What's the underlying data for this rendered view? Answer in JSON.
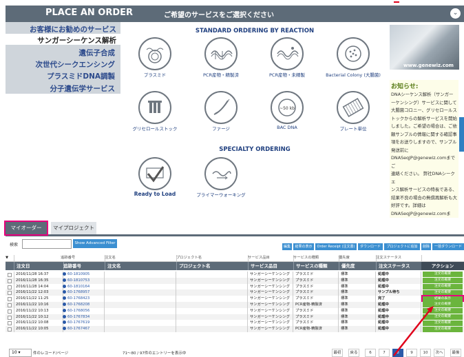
{
  "header": {
    "title": "PLACE AN ORDER",
    "prompt": "ご希望のサービスをご選択ください",
    "collapse_icon": "chevron-down-icon"
  },
  "sidebar": {
    "items": [
      {
        "label": "お客様にお勧めのサービス"
      },
      {
        "label": "サンガーシーケンス解析"
      },
      {
        "label": "遺伝子合成"
      },
      {
        "label": "次世代シークエンシング"
      },
      {
        "label": "プラスミドDNA調製"
      },
      {
        "label": "分子遺伝学サービス"
      }
    ]
  },
  "main": {
    "standard_title": "STANDARD ORDERING BY REACTION",
    "products": [
      {
        "label": "プラスミド",
        "icon": "plasmid-icon"
      },
      {
        "label": "PCR産物・精製済",
        "icon": "pcr-purified-icon"
      },
      {
        "label": "PCR産物・未精製",
        "icon": "pcr-unpurified-icon"
      },
      {
        "label": "Bacterial Colony (大腸菌)",
        "icon": "bacterial-colony-icon"
      },
      {
        "label": "グリセロールストック",
        "icon": "glycerol-stock-icon"
      },
      {
        "label": "ファージ",
        "icon": "phage-icon"
      },
      {
        "label": "BAC DNA",
        "icon": "bac-dna-icon",
        "badge": "~50 kb"
      },
      {
        "label": "プレート単位",
        "icon": "plate-icon"
      }
    ],
    "specialty_title": "SPECIALTY ORDERING",
    "specialty": [
      {
        "label": "Ready to Load",
        "icon": "ready-to-load-icon"
      },
      {
        "label": "プライマーウォーキング",
        "icon": "primer-walking-icon"
      }
    ]
  },
  "right_panel": {
    "photo_caption": "www.genewiz.com",
    "news_title": "お知らせ:",
    "news_lines": [
      "DNAシーケンス解析（サンガー",
      "ーケンシング）サービスに関して",
      "大腸菌コロニー、グリセロールス",
      "トックからの解析サービスを開始",
      "しました。ご希望の場合は、ご依",
      "頼サンプルの情報に関する確認事",
      "項をお送りしますので、サンプル",
      "発送前に",
      "DNASeqJP@genewiz.comまでご",
      "連絡ください。 弊社DNAシークエ",
      "ンス解析サービスの特長である、",
      "結果不良の場合の無償再解析も大",
      "好評です。詳細は",
      "DNASeqJP@genewiz.comまで。"
    ]
  },
  "tabs": [
    {
      "label": "マイオーダー"
    },
    {
      "label": "マイプロジェクト"
    }
  ],
  "search": {
    "label": "検索",
    "advanced_button": "Show Advanced Filter"
  },
  "toolbar": [
    {
      "label": "編集"
    },
    {
      "label": "結果の表示"
    },
    {
      "label": "Order Receipt (注文書)"
    },
    {
      "label": "ダウンロード"
    },
    {
      "label": "プロジェクトに追加"
    },
    {
      "label": "削除"
    },
    {
      "label": "一括ダウンロード"
    }
  ],
  "table": {
    "filter_labels": [
      "追跡番号",
      "注文名",
      "プロジェクト名",
      "サービス品目",
      "サービスの種類",
      "優先度",
      "注文ステータス"
    ],
    "columns": [
      "注文日",
      "追跡番号",
      "注文名",
      "プロジェクト名",
      "サービス品目",
      "サービスの種類",
      "優先度",
      "注文ステータス",
      "アクション"
    ],
    "rows": [
      {
        "date": "2016/11/28 16:37",
        "tracking": "60-1810905",
        "service": "サンガーシーケンシング",
        "type": "プラスミド",
        "priority": "標準",
        "status": "処理中",
        "action": "注文の概要"
      },
      {
        "date": "2016/11/28 16:35",
        "tracking": "60-1810753",
        "service": "サンガーシーケンシング",
        "type": "プラスミド",
        "priority": "標準",
        "status": "処理中",
        "action": "注文の概要"
      },
      {
        "date": "2016/11/28 14:04",
        "tracking": "60-1810164",
        "service": "サンガーシーケンシング",
        "type": "プラスミド",
        "priority": "標準",
        "status": "処理中",
        "action": "注文の概要"
      },
      {
        "date": "2016/11/22 12:03",
        "tracking": "60-1768957",
        "service": "サンガーシーケンシング",
        "type": "プラスミド",
        "priority": "標準",
        "status": "サンプル待ち",
        "action": "注文の概要"
      },
      {
        "date": "2016/11/22 11:25",
        "tracking": "60-1768423",
        "service": "サンガーシーケンシング",
        "type": "プラスミド",
        "priority": "標準",
        "status": "完了",
        "action": "結果の表示"
      },
      {
        "date": "2016/11/22 10:16",
        "tracking": "60-1768208",
        "service": "サンガーシーケンシング",
        "type": "PCR産物-精製済",
        "priority": "標準",
        "status": "処理中",
        "action": "注文の概要"
      },
      {
        "date": "2016/11/22 10:13",
        "tracking": "60-1768056",
        "service": "サンガーシーケンシング",
        "type": "プラスミド",
        "priority": "標準",
        "status": "処理中",
        "action": "注文の概要"
      },
      {
        "date": "2016/11/22 10:12",
        "tracking": "60-1767834",
        "service": "サンガーシーケンシング",
        "type": "プラスミド",
        "priority": "標準",
        "status": "処理中",
        "action": "注文の概要"
      },
      {
        "date": "2016/11/22 10:08",
        "tracking": "60-1767619",
        "service": "サンガーシーケンシング",
        "type": "プラスミド",
        "priority": "標準",
        "status": "処理中",
        "action": "注文の概要"
      },
      {
        "date": "2016/11/22 10:05",
        "tracking": "60-1767467",
        "service": "サンガーシーケンシング",
        "type": "PCR産物-精製済",
        "priority": "標準",
        "status": "処理中",
        "action": "注文の概要"
      }
    ]
  },
  "footer": {
    "per_page": "10",
    "per_page_label": "件のレコード/ページ",
    "count": "71〜80 / 97件のエントリーを表示中",
    "pages": [
      "最初",
      "戻る",
      "6",
      "7",
      "8",
      "9",
      "10",
      "次へ",
      "最後"
    ],
    "current_page": "8"
  },
  "colors": {
    "header_bg": "#5d6b78",
    "link_blue": "#2c4a8c",
    "action_green": "#6bb53d",
    "highlight": "#e8007d",
    "arrow_red": "#e0001b"
  }
}
